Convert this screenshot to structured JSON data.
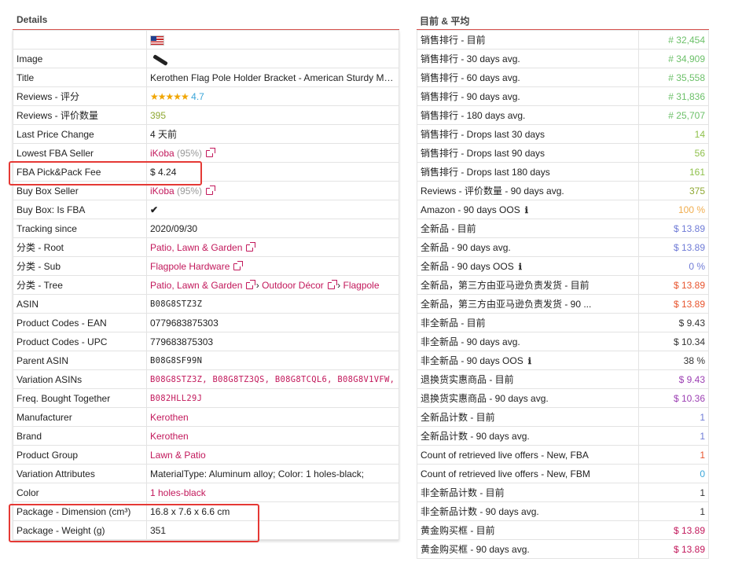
{
  "left": {
    "title": "Details",
    "image_row": "Image",
    "title_row": {
      "k": "Title",
      "v": "Kerothen Flag Pole Holder Bracket - American Sturdy Multi"
    },
    "reviews_rating": {
      "k": "Reviews - 评分",
      "v": "4.7",
      "stars": "★★★★★"
    },
    "reviews_count": {
      "k": "Reviews - 评价数量",
      "v": "395"
    },
    "last_price_change": {
      "k": "Last Price Change",
      "v": "4 天前"
    },
    "lowest_fba": {
      "k": "Lowest FBA Seller",
      "name": "iKoba",
      "pct": "(95%)"
    },
    "fba_fee": {
      "k": "FBA Pick&Pack Fee",
      "v": "$ 4.24"
    },
    "buybox_seller": {
      "k": "Buy Box Seller",
      "name": "iKoba",
      "pct": "(95%)"
    },
    "buybox_fba": {
      "k": "Buy Box: Is FBA",
      "v": "✔"
    },
    "tracking": {
      "k": "Tracking since",
      "v": "2020/09/30"
    },
    "cat_root": {
      "k": "分类 - Root",
      "v": "Patio, Lawn & Garden"
    },
    "cat_sub": {
      "k": "分类 - Sub",
      "v": "Flagpole Hardware"
    },
    "cat_tree": {
      "k": "分类 - Tree",
      "v1": "Patio, Lawn & Garden",
      "v2": "Outdoor Décor",
      "v3": "Flagpole",
      "sep": "›"
    },
    "asin": {
      "k": "ASIN",
      "v": "B08G8STZ3Z"
    },
    "ean": {
      "k": "Product Codes - EAN",
      "v": "0779683875303"
    },
    "upc": {
      "k": "Product Codes - UPC",
      "v": "779683875303"
    },
    "parent": {
      "k": "Parent ASIN",
      "v": "B08G8SF99N"
    },
    "variations": {
      "k": "Variation ASINs",
      "v": "B08G8STZ3Z, B08G8TZ3QS, B08G8TCQL6, B08G8V1VFW,"
    },
    "fbt": {
      "k": "Freq. Bought Together",
      "v": "B082HLL29J"
    },
    "manufacturer": {
      "k": "Manufacturer",
      "v": "Kerothen"
    },
    "brand": {
      "k": "Brand",
      "v": "Kerothen"
    },
    "group": {
      "k": "Product Group",
      "v": "Lawn & Patio"
    },
    "var_attr": {
      "k": "Variation Attributes",
      "v": "MaterialType: Aluminum alloy; Color: 1 holes-black;"
    },
    "color": {
      "k": "Color",
      "v": "1 holes-black"
    },
    "dimension": {
      "k": "Package - Dimension (cm³)",
      "v": "16.8 x 7.6 x 6.6 cm"
    },
    "weight": {
      "k": "Package - Weight (g)",
      "v": "351"
    }
  },
  "right": {
    "title": "目前 & 平均",
    "rows": [
      {
        "k": "销售排行 - 目前",
        "v": "# 32,454",
        "c": "green"
      },
      {
        "k": "销售排行 - 30 days avg.",
        "v": "# 34,909",
        "c": "green"
      },
      {
        "k": "销售排行 - 60 days avg.",
        "v": "# 35,558",
        "c": "green"
      },
      {
        "k": "销售排行 - 90 days avg.",
        "v": "# 31,836",
        "c": "green"
      },
      {
        "k": "销售排行 - 180 days avg.",
        "v": "# 25,707",
        "c": "green"
      },
      {
        "k": "销售排行 - Drops last 30 days",
        "v": "14",
        "c": "lime"
      },
      {
        "k": "销售排行 - Drops last 90 days",
        "v": "56",
        "c": "lime"
      },
      {
        "k": "销售排行 - Drops last 180 days",
        "v": "161",
        "c": "lime"
      },
      {
        "k": "Reviews - 评价数量 - 90 days avg.",
        "v": "375",
        "c": "olive"
      },
      {
        "k": "Amazon - 90 days OOS",
        "v": "100 %",
        "c": "orange",
        "info": true
      },
      {
        "k": "全新品 - 目前",
        "v": "$ 13.89",
        "c": "blue-ish"
      },
      {
        "k": "全新品 - 90 days avg.",
        "v": "$ 13.89",
        "c": "blue-ish"
      },
      {
        "k": "全新品 - 90 days OOS",
        "v": "0 %",
        "c": "blue-ish",
        "info": true
      },
      {
        "k": "全新品，第三方由亚马逊负责发货 - 目前",
        "v": "$ 13.89",
        "c": "red"
      },
      {
        "k": "全新品，第三方由亚马逊负责发货 - 90 ...",
        "v": "$ 13.89",
        "c": "red"
      },
      {
        "k": "非全新品 - 目前",
        "v": "$ 9.43",
        "c": "dark"
      },
      {
        "k": "非全新品 - 90 days avg.",
        "v": "$ 10.34",
        "c": "dark"
      },
      {
        "k": "非全新品 - 90 days OOS",
        "v": "38 %",
        "c": "dark",
        "info": true
      },
      {
        "k": "退换货实惠商品 - 目前",
        "v": "$ 9.43",
        "c": "purple"
      },
      {
        "k": "退换货实惠商品 - 90 days avg.",
        "v": "$ 10.36",
        "c": "purple"
      },
      {
        "k": "全新品计数 - 目前",
        "v": "1",
        "c": "blue-ish"
      },
      {
        "k": "全新品计数 - 90 days avg.",
        "v": "1",
        "c": "blue-ish"
      },
      {
        "k": "Count of retrieved live offers - New, FBA",
        "v": "1",
        "c": "red"
      },
      {
        "k": "Count of retrieved live offers - New, FBM",
        "v": "0",
        "c": "cyan"
      },
      {
        "k": "非全新品计数 - 目前",
        "v": "1",
        "c": "dark"
      },
      {
        "k": "非全新品计数 - 90 days avg.",
        "v": "1",
        "c": "dark"
      },
      {
        "k": "黄金购买框 - 目前",
        "v": "$ 13.89",
        "c": "pink"
      },
      {
        "k": "黄金购买框 - 90 days avg.",
        "v": "$ 13.89",
        "c": "pink"
      }
    ]
  },
  "colors": {
    "accent": "#c2185b",
    "highlight": "#e53935",
    "header_rule": "#d9534f"
  }
}
